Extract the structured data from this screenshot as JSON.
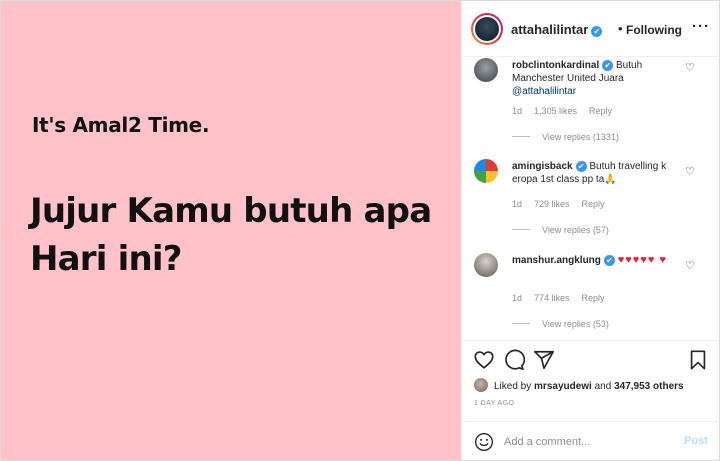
{
  "post": {
    "line1": "It's Amal2 Time.",
    "line2a": "Jujur Kamu butuh apa",
    "line2b": "Hari ini?"
  },
  "header": {
    "username": "attahalilintar",
    "verified_glyph": "✔",
    "separator": "•",
    "following_label": "Following",
    "more_label": "···"
  },
  "comments": [
    {
      "username": "robclintonkardinal",
      "text": "Butuh Manchester United Juara",
      "mention": "@attahalilintar",
      "age": "1d",
      "likes": "1,305 likes",
      "reply_label": "Reply",
      "view_replies": "View replies (1331)"
    },
    {
      "username": "amingisback",
      "text": "Butuh travelling k eropa 1st class pp ta🙏",
      "age": "1d",
      "likes": "729 likes",
      "reply_label": "Reply",
      "view_replies": "View replies (57)"
    },
    {
      "username": "manshur.angklung",
      "text": "♥♥♥♥♥ ♥",
      "age": "1d",
      "likes": "774 likes",
      "reply_label": "Reply",
      "view_replies": "View replies (53)"
    }
  ],
  "likes": {
    "prefix": "Liked by",
    "user": "mrsayudewi",
    "conjunction": "and",
    "others": "347,953 others"
  },
  "timestamp": "1 DAY AGO",
  "add_comment": {
    "placeholder": "Add a comment...",
    "post_label": "Post"
  },
  "colors": {
    "image_bg": "#ffc2c8",
    "verified": "#3897f0",
    "post_button": "#b2dffc"
  },
  "icons": [
    "heart-icon",
    "comment-icon",
    "share-icon",
    "bookmark-icon",
    "emoji-icon",
    "more-icon"
  ]
}
